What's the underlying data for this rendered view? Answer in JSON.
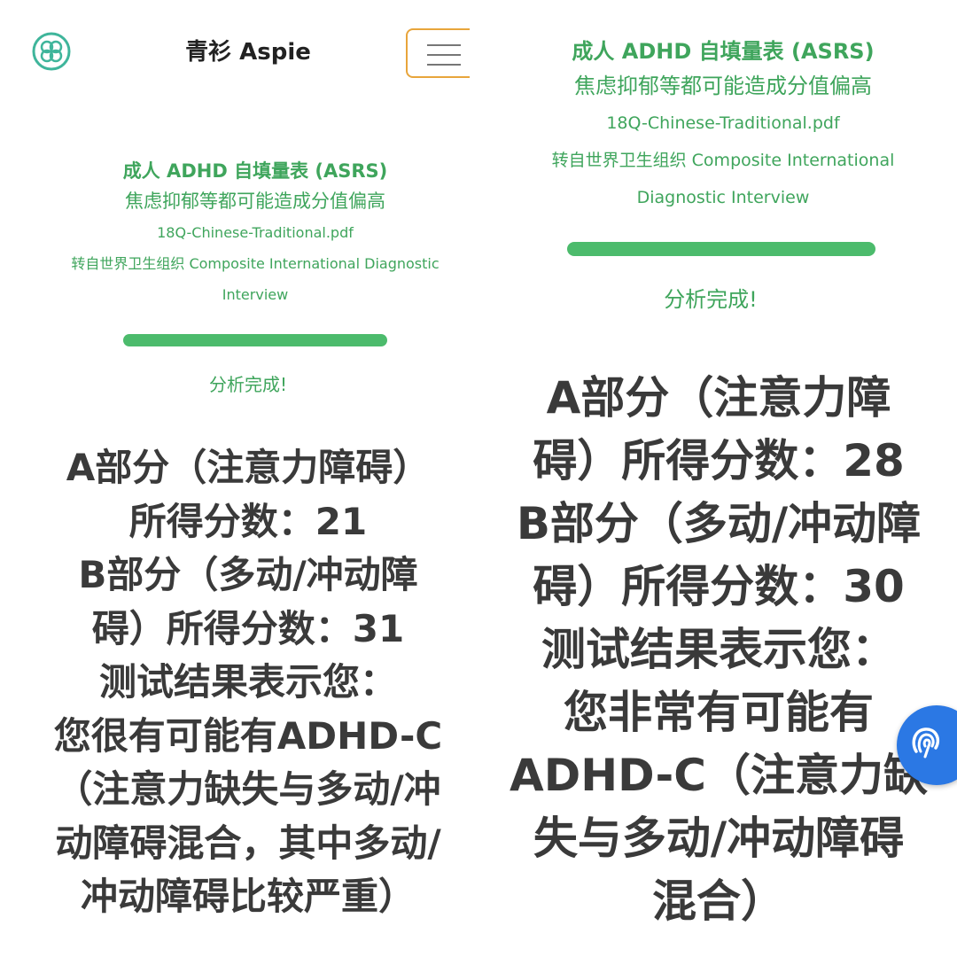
{
  "left": {
    "app_title": "青衫 Aspie",
    "info": {
      "title": "成人 ADHD 自填量表 (ASRS)",
      "note": "焦虑抑郁等都可能造成分值偏高",
      "file": "18Q-Chinese-Traditional.pdf",
      "source_line1": "转自世界卫生组织 Composite International Diagnostic",
      "source_line2": "Interview"
    },
    "progress_fraction": 1.0,
    "status": "分析完成!",
    "result_lines": [
      "A部分（注意力障碍）",
      "所得分数：21",
      "B部分（多动/冲动障",
      "碍）所得分数：31",
      "测试结果表示您：",
      "您很有可能有ADHD-C",
      "（注意力缺失与多动/冲",
      "动障碍混合，其中多动/",
      "冲动障碍比较严重）"
    ]
  },
  "right": {
    "info": {
      "title": "成人 ADHD 自填量表 (ASRS)",
      "note": "焦虑抑郁等都可能造成分值偏高",
      "file": "18Q-Chinese-Traditional.pdf",
      "source_line1": "转自世界卫生组织 Composite International",
      "source_line2": "Diagnostic Interview"
    },
    "progress_fraction": 1.0,
    "status": "分析完成!",
    "result_lines": [
      "A部分（注意力障",
      "碍）所得分数：28",
      "B部分（多动/冲动障",
      "碍）所得分数：30",
      "测试结果表示您：",
      "您非常有可能有",
      "ADHD-C（注意力缺",
      "失与多动/冲动障碍",
      "混合）"
    ]
  },
  "icons": {
    "logo": "flower-logo-icon",
    "menu": "hamburger-menu-icon",
    "fab": "accessibility-icon"
  },
  "colors": {
    "accent_green": "#3fa55c",
    "progress_green": "#4cbb6c",
    "menu_border": "#e8a53b",
    "fab_blue": "#2b78e4",
    "result_text": "#3a3a3a"
  }
}
